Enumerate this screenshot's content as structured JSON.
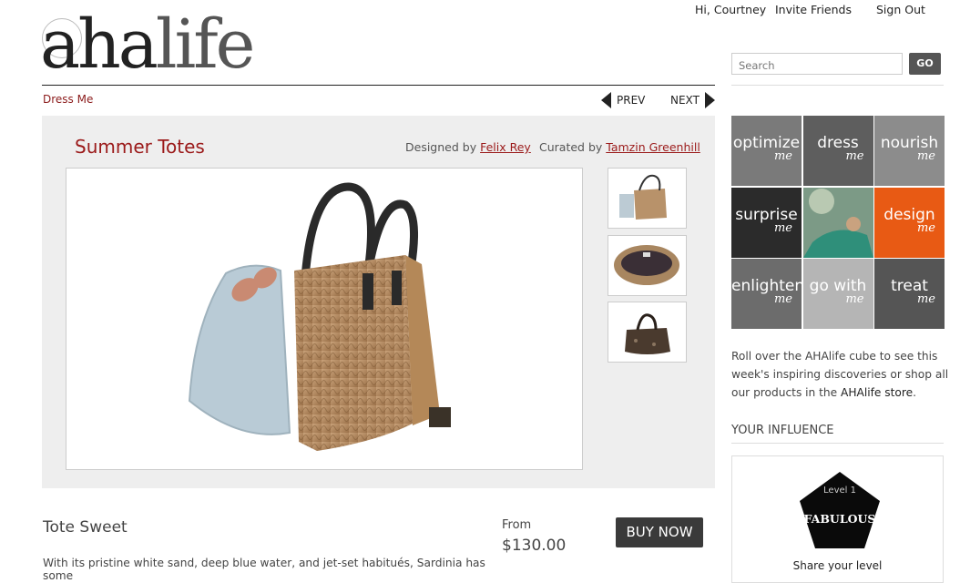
{
  "topnav": {
    "greeting_prefix": "Hi,",
    "user_name": "Courtney",
    "invite": "Invite Friends",
    "signout": "Sign Out"
  },
  "logo": {
    "text_aha": "aha",
    "text_life": "life"
  },
  "breadcrumb": "Dress Me",
  "pager": {
    "prev": "PREV",
    "next": "NEXT"
  },
  "search": {
    "placeholder": "Search",
    "button": "GO"
  },
  "product": {
    "title": "Summer Totes",
    "designed_label": "Designed by",
    "designer": "Felix Rey",
    "curated_label": "Curated by",
    "curator": "Tamzin Greenhill",
    "item_name": "Tote Sweet",
    "from_label": "From",
    "price": "$130.00",
    "buy_label": "BUY NOW",
    "description": "With its pristine white sand, deep blue water, and jet-set habitués, Sardinia has some"
  },
  "cube": [
    {
      "word": "optimize",
      "sub": "me",
      "color": "#7a7a7a"
    },
    {
      "word": "dress",
      "sub": "me",
      "color": "#5e5e5e"
    },
    {
      "word": "nourish",
      "sub": "me",
      "color": "#8c8c8c"
    },
    {
      "word": "surprise",
      "sub": "me",
      "color": "#2b2b2b"
    },
    {
      "word": "",
      "sub": "",
      "color": "#6f8f7a"
    },
    {
      "word": "design",
      "sub": "me",
      "color": "#e85a14"
    },
    {
      "word": "enlighten",
      "sub": "me",
      "color": "#6c6c6c"
    },
    {
      "word": "go with",
      "sub": "me",
      "color": "#b5b5b5"
    },
    {
      "word": "treat",
      "sub": "me",
      "color": "#555555"
    }
  ],
  "blurb": {
    "text": "Roll over the AHAlife cube to see this week's inspiring discoveries or shop all our products in the",
    "store": "AHAlife store",
    "end": "."
  },
  "influence": {
    "title": "YOUR INFLUENCE",
    "level": "Level 1",
    "badge": "FABULOUS",
    "share": "Share your level"
  },
  "colors": {
    "accent": "#9b1a1a",
    "orange": "#e85a14"
  }
}
